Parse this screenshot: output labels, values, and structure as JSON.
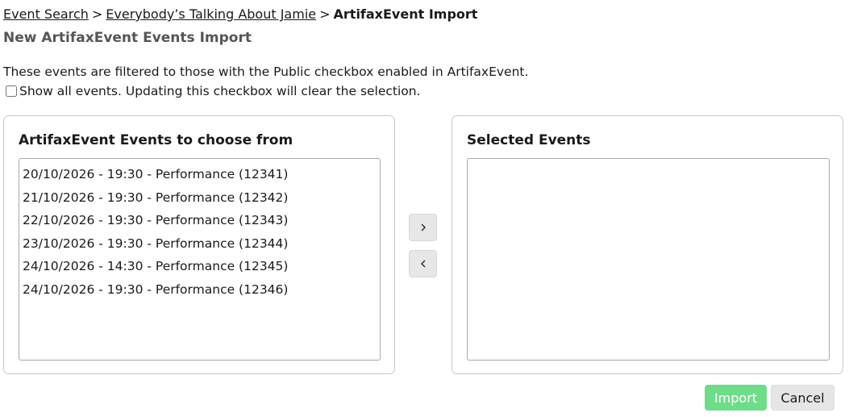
{
  "breadcrumb": {
    "items": [
      "Event Search",
      "Everybody’s Talking About Jamie"
    ],
    "separator": ">",
    "current": "ArtifaxEvent Import"
  },
  "page_title": "New ArtifaxEvent Events Import",
  "filter_note": "These events are filtered to those with the Public checkbox enabled in ArtifaxEvent.",
  "show_all": {
    "label": "Show all events. Updating this checkbox will clear the selection.",
    "checked": false
  },
  "available": {
    "heading": "ArtifaxEvent Events to choose from",
    "events": [
      "20/10/2026 - 19:30 - Performance (12341)",
      "21/10/2026 - 19:30 - Performance (12342)",
      "22/10/2026 - 19:30 - Performance (12343)",
      "23/10/2026 - 19:30 - Performance (12344)",
      "24/10/2026 - 14:30 - Performance (12345)",
      "24/10/2026 - 19:30 - Performance (12346)"
    ]
  },
  "selected": {
    "heading": "Selected Events",
    "events": []
  },
  "icons": {
    "add": "chevron-right-icon",
    "remove": "chevron-left-icon"
  },
  "actions": {
    "import_label": "Import",
    "cancel_label": "Cancel"
  },
  "colors": {
    "import_bg": "#6fdc8a",
    "cancel_bg": "#e6e6e6"
  }
}
